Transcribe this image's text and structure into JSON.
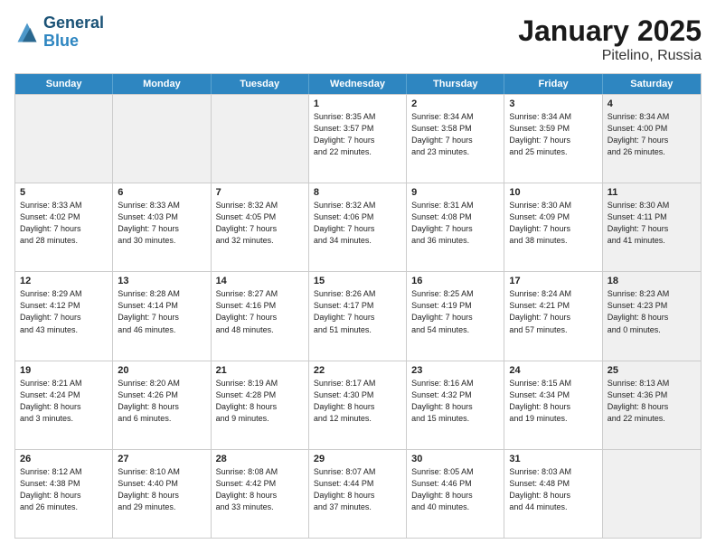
{
  "header": {
    "logo_general": "General",
    "logo_blue": "Blue",
    "month_title": "January 2025",
    "location": "Pitelino, Russia"
  },
  "days_of_week": [
    "Sunday",
    "Monday",
    "Tuesday",
    "Wednesday",
    "Thursday",
    "Friday",
    "Saturday"
  ],
  "weeks": [
    [
      {
        "day": "",
        "info": "",
        "shaded": true
      },
      {
        "day": "",
        "info": "",
        "shaded": true
      },
      {
        "day": "",
        "info": "",
        "shaded": true
      },
      {
        "day": "1",
        "info": "Sunrise: 8:35 AM\nSunset: 3:57 PM\nDaylight: 7 hours\nand 22 minutes."
      },
      {
        "day": "2",
        "info": "Sunrise: 8:34 AM\nSunset: 3:58 PM\nDaylight: 7 hours\nand 23 minutes."
      },
      {
        "day": "3",
        "info": "Sunrise: 8:34 AM\nSunset: 3:59 PM\nDaylight: 7 hours\nand 25 minutes."
      },
      {
        "day": "4",
        "info": "Sunrise: 8:34 AM\nSunset: 4:00 PM\nDaylight: 7 hours\nand 26 minutes.",
        "shaded": true
      }
    ],
    [
      {
        "day": "5",
        "info": "Sunrise: 8:33 AM\nSunset: 4:02 PM\nDaylight: 7 hours\nand 28 minutes."
      },
      {
        "day": "6",
        "info": "Sunrise: 8:33 AM\nSunset: 4:03 PM\nDaylight: 7 hours\nand 30 minutes."
      },
      {
        "day": "7",
        "info": "Sunrise: 8:32 AM\nSunset: 4:05 PM\nDaylight: 7 hours\nand 32 minutes."
      },
      {
        "day": "8",
        "info": "Sunrise: 8:32 AM\nSunset: 4:06 PM\nDaylight: 7 hours\nand 34 minutes."
      },
      {
        "day": "9",
        "info": "Sunrise: 8:31 AM\nSunset: 4:08 PM\nDaylight: 7 hours\nand 36 minutes."
      },
      {
        "day": "10",
        "info": "Sunrise: 8:30 AM\nSunset: 4:09 PM\nDaylight: 7 hours\nand 38 minutes."
      },
      {
        "day": "11",
        "info": "Sunrise: 8:30 AM\nSunset: 4:11 PM\nDaylight: 7 hours\nand 41 minutes.",
        "shaded": true
      }
    ],
    [
      {
        "day": "12",
        "info": "Sunrise: 8:29 AM\nSunset: 4:12 PM\nDaylight: 7 hours\nand 43 minutes."
      },
      {
        "day": "13",
        "info": "Sunrise: 8:28 AM\nSunset: 4:14 PM\nDaylight: 7 hours\nand 46 minutes."
      },
      {
        "day": "14",
        "info": "Sunrise: 8:27 AM\nSunset: 4:16 PM\nDaylight: 7 hours\nand 48 minutes."
      },
      {
        "day": "15",
        "info": "Sunrise: 8:26 AM\nSunset: 4:17 PM\nDaylight: 7 hours\nand 51 minutes."
      },
      {
        "day": "16",
        "info": "Sunrise: 8:25 AM\nSunset: 4:19 PM\nDaylight: 7 hours\nand 54 minutes."
      },
      {
        "day": "17",
        "info": "Sunrise: 8:24 AM\nSunset: 4:21 PM\nDaylight: 7 hours\nand 57 minutes."
      },
      {
        "day": "18",
        "info": "Sunrise: 8:23 AM\nSunset: 4:23 PM\nDaylight: 8 hours\nand 0 minutes.",
        "shaded": true
      }
    ],
    [
      {
        "day": "19",
        "info": "Sunrise: 8:21 AM\nSunset: 4:24 PM\nDaylight: 8 hours\nand 3 minutes."
      },
      {
        "day": "20",
        "info": "Sunrise: 8:20 AM\nSunset: 4:26 PM\nDaylight: 8 hours\nand 6 minutes."
      },
      {
        "day": "21",
        "info": "Sunrise: 8:19 AM\nSunset: 4:28 PM\nDaylight: 8 hours\nand 9 minutes."
      },
      {
        "day": "22",
        "info": "Sunrise: 8:17 AM\nSunset: 4:30 PM\nDaylight: 8 hours\nand 12 minutes."
      },
      {
        "day": "23",
        "info": "Sunrise: 8:16 AM\nSunset: 4:32 PM\nDaylight: 8 hours\nand 15 minutes."
      },
      {
        "day": "24",
        "info": "Sunrise: 8:15 AM\nSunset: 4:34 PM\nDaylight: 8 hours\nand 19 minutes."
      },
      {
        "day": "25",
        "info": "Sunrise: 8:13 AM\nSunset: 4:36 PM\nDaylight: 8 hours\nand 22 minutes.",
        "shaded": true
      }
    ],
    [
      {
        "day": "26",
        "info": "Sunrise: 8:12 AM\nSunset: 4:38 PM\nDaylight: 8 hours\nand 26 minutes."
      },
      {
        "day": "27",
        "info": "Sunrise: 8:10 AM\nSunset: 4:40 PM\nDaylight: 8 hours\nand 29 minutes."
      },
      {
        "day": "28",
        "info": "Sunrise: 8:08 AM\nSunset: 4:42 PM\nDaylight: 8 hours\nand 33 minutes."
      },
      {
        "day": "29",
        "info": "Sunrise: 8:07 AM\nSunset: 4:44 PM\nDaylight: 8 hours\nand 37 minutes."
      },
      {
        "day": "30",
        "info": "Sunrise: 8:05 AM\nSunset: 4:46 PM\nDaylight: 8 hours\nand 40 minutes."
      },
      {
        "day": "31",
        "info": "Sunrise: 8:03 AM\nSunset: 4:48 PM\nDaylight: 8 hours\nand 44 minutes."
      },
      {
        "day": "",
        "info": "",
        "shaded": true
      }
    ]
  ]
}
